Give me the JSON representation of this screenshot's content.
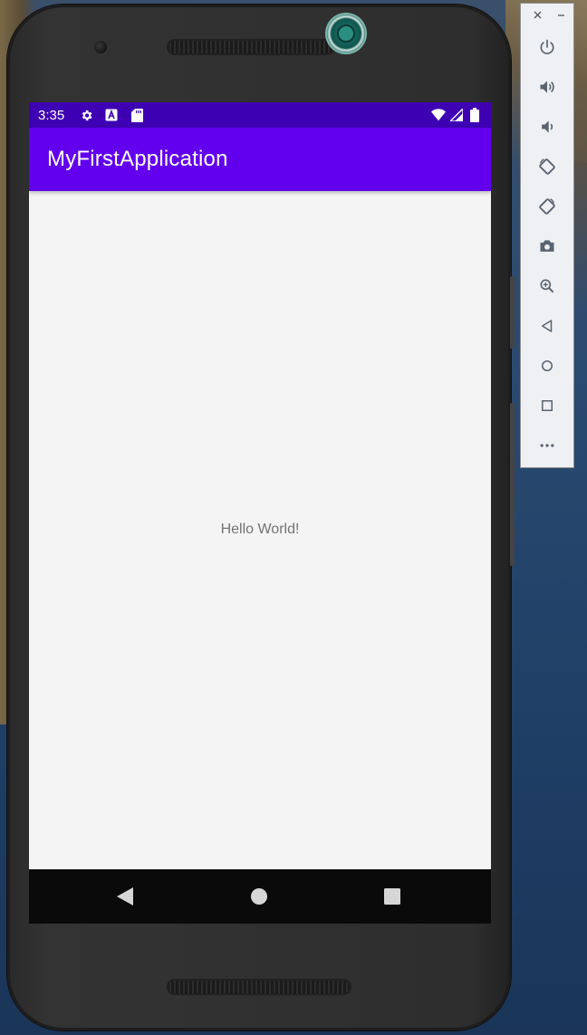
{
  "status_bar": {
    "time": "3:35",
    "icons": [
      "settings-icon",
      "a-notification-icon",
      "sd-card-icon",
      "wifi-icon",
      "signal-icon",
      "battery-icon"
    ],
    "color": "#3e00b3"
  },
  "app_bar": {
    "title": "MyFirstApplication",
    "color": "#6200ee"
  },
  "content": {
    "text": "Hello World!"
  },
  "nav_bar": {
    "buttons": [
      "back-icon",
      "home-icon",
      "recents-icon"
    ]
  },
  "emulator_panel": {
    "window_controls": [
      "close-icon",
      "minimize-icon"
    ],
    "buttons": [
      "power-icon",
      "volume-up-icon",
      "volume-down-icon",
      "rotate-left-icon",
      "rotate-right-icon",
      "camera-icon",
      "zoom-icon",
      "back-icon",
      "home-icon",
      "overview-icon",
      "more-icon"
    ]
  }
}
